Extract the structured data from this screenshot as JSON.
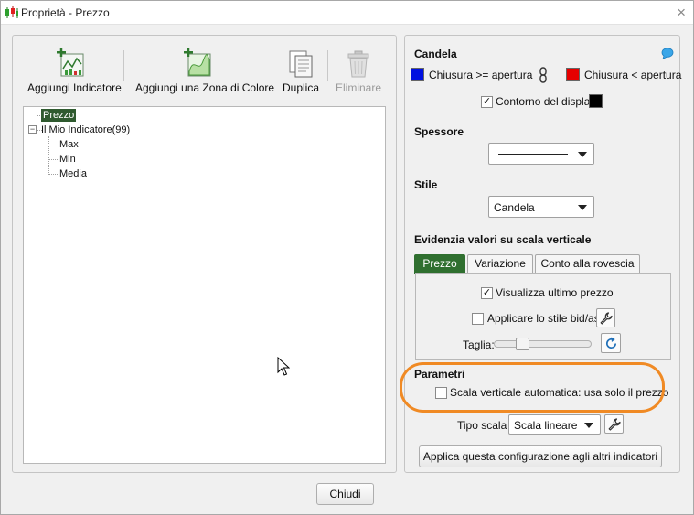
{
  "window": {
    "title": "Proprietà - Prezzo",
    "close_glyph": "×"
  },
  "toolbar": {
    "add_indicator": "Aggiungi Indicatore",
    "add_color_zone": "Aggiungi una Zona di Colore",
    "duplicate": "Duplica",
    "delete": "Eliminare"
  },
  "tree": {
    "root": "Prezzo",
    "indicator": "Il Mio Indicatore(99)",
    "indicator_expander": "−",
    "children": [
      "Max",
      "Min",
      "Media"
    ]
  },
  "candela": {
    "title": "Candela",
    "close_ge_open": "Chiusura >= apertura",
    "close_lt_open": "Chiusura < apertura",
    "display_outline": "Contorno del display",
    "display_outline_checked": "✓",
    "colors": {
      "up": "#0010e0",
      "down": "#e60000",
      "outline": "#000000"
    }
  },
  "spessore": {
    "title": "Spessore"
  },
  "stile": {
    "title": "Stile",
    "value": "Candela"
  },
  "evidenzia": {
    "title": "Evidenzia valori su scala verticale",
    "tabs": [
      "Prezzo",
      "Variazione",
      "Conto alla rovescia"
    ],
    "active_tab": 0,
    "show_last_price": "Visualizza ultimo prezzo",
    "show_last_price_checked": "✓",
    "bid_ask_style": "Applicare lo stile bid/ask",
    "size_label": "Taglia:",
    "size_level": 0.25
  },
  "parametri": {
    "title": "Parametri",
    "auto_scale": "Scala verticale automatica: usa solo il prezzo"
  },
  "scale": {
    "label": "Tipo scala",
    "value": "Scala lineare"
  },
  "apply_all": "Applica questa configurazione agli altri indicatori",
  "close_button": "Chiudi",
  "colors": {
    "accent_green": "#2f6f2f",
    "highlight_orange": "#f08a24"
  }
}
